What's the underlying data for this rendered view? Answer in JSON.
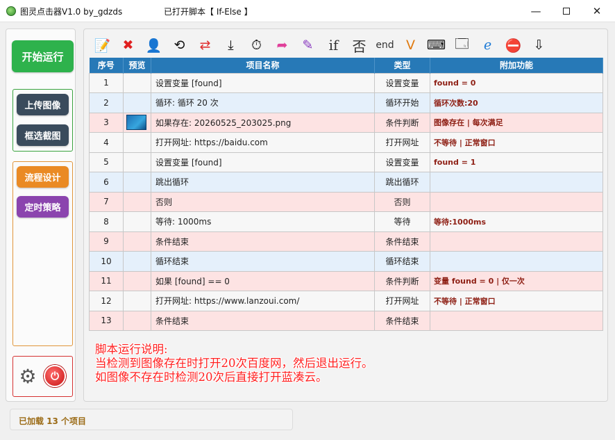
{
  "window": {
    "app_title": "图灵点击器V1.0 by_gdzds",
    "script_title": "已打开脚本【 If-Else 】",
    "minimize": "—",
    "maximize": "",
    "close": "✕"
  },
  "sidebar": {
    "start_label": "开始运行",
    "upload_label": "上传图像",
    "crop_label": "框选截图",
    "flow_label": "流程设计",
    "schedule_label": "定时策略"
  },
  "toolbar": {
    "icons": [
      {
        "name": "edit-icon",
        "glyph": "📝"
      },
      {
        "name": "delete-icon",
        "glyph": "✖",
        "color": "#e02020"
      },
      {
        "name": "person-icon",
        "glyph": "👤"
      },
      {
        "name": "loop-icon",
        "glyph": "⟲"
      },
      {
        "name": "shuffle-icon",
        "glyph": "⇄",
        "color": "#e03030"
      },
      {
        "name": "download-arrow-icon",
        "glyph": "⤓"
      },
      {
        "name": "stopwatch-icon",
        "glyph": "⏱"
      },
      {
        "name": "redirect-arrow-icon",
        "glyph": "➦",
        "color": "#e0409a"
      },
      {
        "name": "feather-icon",
        "glyph": "✎",
        "color": "#8a3cc0"
      },
      {
        "name": "if-icon",
        "text": "if"
      },
      {
        "name": "else-icon",
        "text": "否"
      },
      {
        "name": "end-icon",
        "text": "end"
      },
      {
        "name": "variable-icon",
        "glyph": "V",
        "color": "#e07a10"
      },
      {
        "name": "keyboard-icon",
        "glyph": "⌨"
      },
      {
        "name": "window-icon",
        "glyph": "🗔"
      },
      {
        "name": "browser-icon",
        "glyph": "ℯ",
        "color": "#1d7ad6"
      },
      {
        "name": "stop-icon",
        "glyph": "⛔"
      },
      {
        "name": "down-arrow-icon",
        "glyph": "⇩"
      }
    ]
  },
  "table": {
    "headers": [
      "序号",
      "预览",
      "项目名称",
      "类型",
      "附加功能"
    ],
    "rows": [
      {
        "num": "1",
        "has_preview": false,
        "name": "设置变量 [found]",
        "type": "设置变量",
        "extra": "found = 0",
        "tone": "white"
      },
      {
        "num": "2",
        "has_preview": false,
        "name": "循环: 循环 20 次",
        "type": "循环开始",
        "extra": "循环次数:20",
        "tone": "blue"
      },
      {
        "num": "3",
        "has_preview": true,
        "name": "如果存在: 20260525_203025.png",
        "type": "条件判断",
        "extra": "图像存在 | 每次满足",
        "tone": "pink"
      },
      {
        "num": "4",
        "has_preview": false,
        "name": "打开网址: https://baidu.com",
        "type": "打开网址",
        "extra": "不等待 | 正常窗口",
        "tone": "white"
      },
      {
        "num": "5",
        "has_preview": false,
        "name": "设置变量 [found]",
        "type": "设置变量",
        "extra": "found = 1",
        "tone": "white"
      },
      {
        "num": "6",
        "has_preview": false,
        "name": "跳出循环",
        "type": "跳出循环",
        "extra": "",
        "tone": "blue"
      },
      {
        "num": "7",
        "has_preview": false,
        "name": "否则",
        "type": "否则",
        "extra": "",
        "tone": "pink"
      },
      {
        "num": "8",
        "has_preview": false,
        "name": "等待: 1000ms",
        "type": "等待",
        "extra": "等待:1000ms",
        "tone": "white"
      },
      {
        "num": "9",
        "has_preview": false,
        "name": "条件结束",
        "type": "条件结束",
        "extra": "",
        "tone": "pink"
      },
      {
        "num": "10",
        "has_preview": false,
        "name": "循环结束",
        "type": "循环结束",
        "extra": "",
        "tone": "blue"
      },
      {
        "num": "11",
        "has_preview": false,
        "name": "如果 [found] == 0",
        "type": "条件判断",
        "extra": "变量 found = 0 | 仅一次",
        "tone": "pink"
      },
      {
        "num": "12",
        "has_preview": false,
        "name": "打开网址: https://www.lanzoui.com/",
        "type": "打开网址",
        "extra": "不等待 | 正常窗口",
        "tone": "white"
      },
      {
        "num": "13",
        "has_preview": false,
        "name": "条件结束",
        "type": "条件结束",
        "extra": "",
        "tone": "pink"
      }
    ]
  },
  "notes": {
    "line1": "脚本运行说明:",
    "line2": "当检测到图像存在时打开20次百度网，然后退出运行。",
    "line3": "如图像不存在时检测20次后直接打开蓝凑云。"
  },
  "status": {
    "text": "已加载 13 个项目"
  }
}
